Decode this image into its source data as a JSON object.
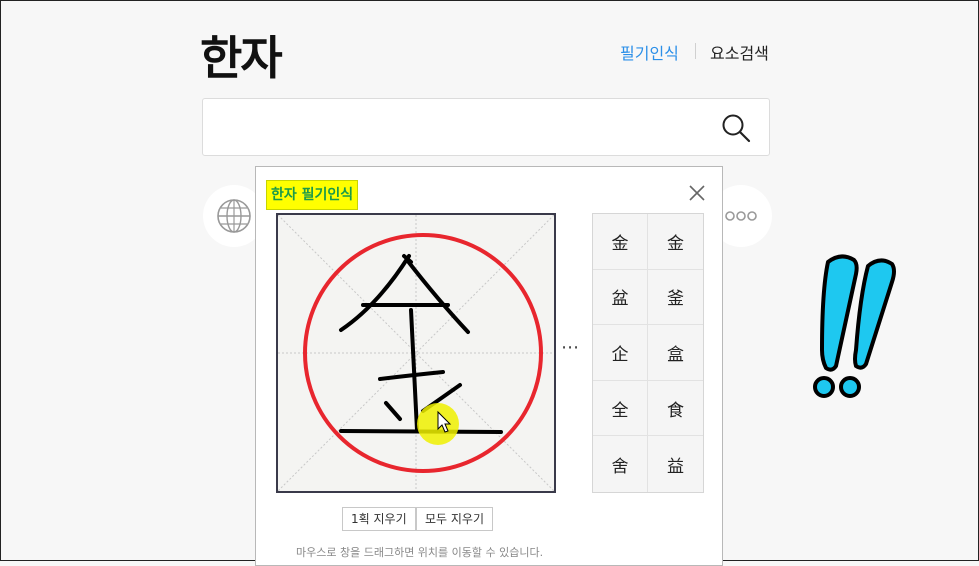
{
  "header": {
    "title": "한자",
    "nav_handwriting": "필기인식",
    "nav_element_search": "요소검색"
  },
  "search": {
    "value": "",
    "placeholder": ""
  },
  "panel": {
    "title": "한자 필기인식",
    "candidates": [
      "金",
      "金",
      "盆",
      "釜",
      "企",
      "盒",
      "全",
      "食",
      "舍",
      "益"
    ],
    "clear_stroke_label": "1획 지우기",
    "clear_all_label": "모두 지우기",
    "hint": "마우스로 창을 드래그하면 위치를 이동할 수 있습니다.",
    "ellipsis": "⋯"
  },
  "colors": {
    "accent": "#2b8fe8",
    "highlight": "#ffff00",
    "title_text": "#1a9a4a",
    "annotation_circle": "#e8262e",
    "exclamation": "#1ec8f0"
  }
}
